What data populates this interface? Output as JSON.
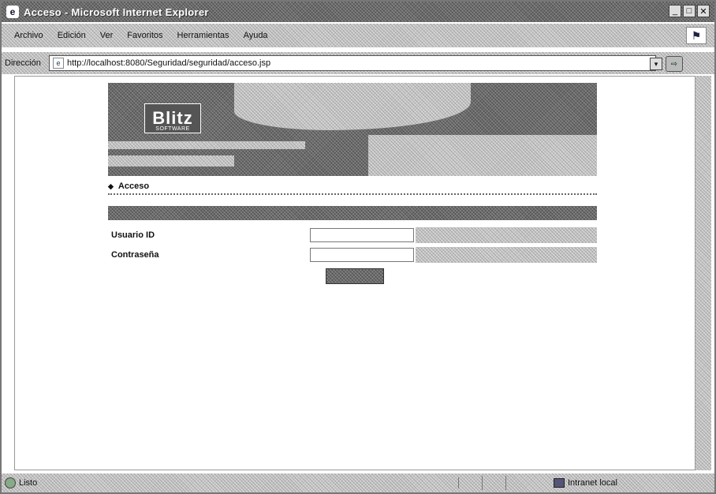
{
  "window": {
    "title": "Acceso - Microsoft Internet Explorer",
    "controls": {
      "minimize": "_",
      "maximize": "□",
      "close": "✕"
    }
  },
  "menu": [
    "Archivo",
    "Edición",
    "Ver",
    "Favoritos",
    "Herramientas",
    "Ayuda"
  ],
  "address": {
    "label": "Dirección",
    "url": "http://localhost:8080/Seguridad/seguridad/acceso.jsp",
    "dropdown": "▾",
    "go": "⇨"
  },
  "page": {
    "logo": "Blitz",
    "logo_sub": "SOFTWARE",
    "nav_item": "Acceso",
    "section_header": "",
    "fields": [
      {
        "label": "Usuario ID",
        "value": ""
      },
      {
        "label": "Contraseña",
        "value": ""
      }
    ],
    "submit_label": ""
  },
  "status": {
    "text": "Listo",
    "zone": "Intranet local"
  },
  "colors": {
    "titlebar": "#3a3a3a",
    "chrome": "#c8c8c8",
    "content_bg": "#ffffff"
  }
}
